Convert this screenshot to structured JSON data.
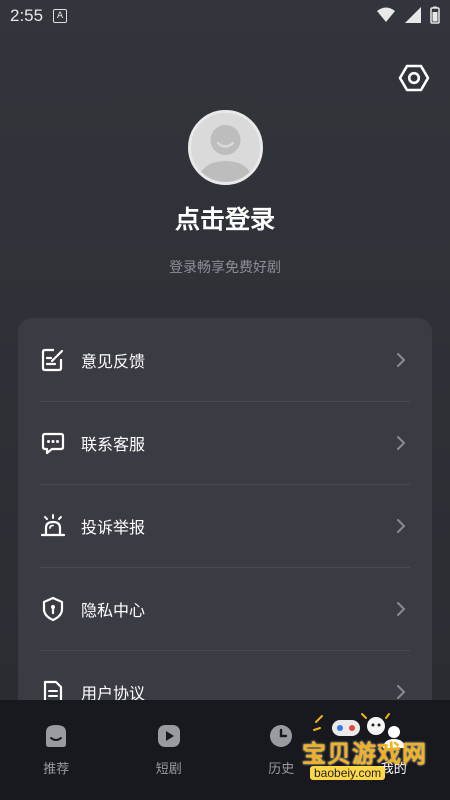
{
  "status_bar": {
    "time": "2:55",
    "notif_letter": "A"
  },
  "profile": {
    "title": "点击登录",
    "subtitle": "登录畅享免费好剧"
  },
  "menu": {
    "items": [
      {
        "label": "意见反馈",
        "icon": "feedback-icon"
      },
      {
        "label": "联系客服",
        "icon": "chat-icon"
      },
      {
        "label": "投诉举报",
        "icon": "alarm-icon"
      },
      {
        "label": "隐私中心",
        "icon": "shield-icon"
      },
      {
        "label": "用户协议",
        "icon": "document-icon"
      }
    ]
  },
  "nav": {
    "items": [
      {
        "label": "推荐"
      },
      {
        "label": "短剧"
      },
      {
        "label": "历史"
      },
      {
        "label": "我的"
      }
    ]
  },
  "watermark": {
    "title": "宝贝游戏网",
    "url": "baobeiy.com"
  },
  "colors": {
    "background": "#2f3036",
    "card": "#3b3c43",
    "nav_bar": "#18191e",
    "muted_text": "#8d8f96"
  }
}
